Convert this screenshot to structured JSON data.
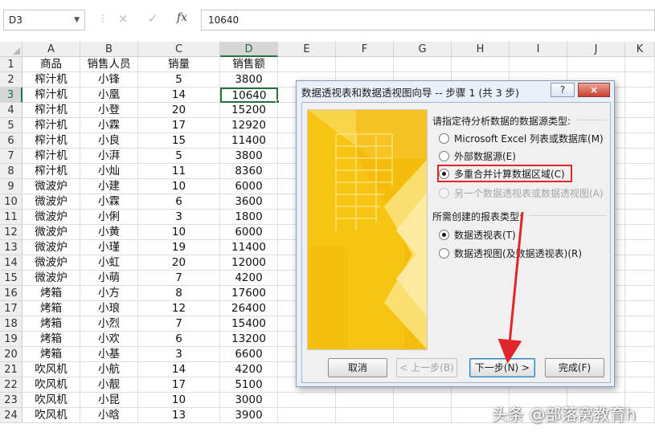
{
  "formula_bar": {
    "name_box": "D3",
    "cancel_icon": "×",
    "enter_icon": "✓",
    "fx_label": "fx",
    "value": "10640"
  },
  "columns": [
    "A",
    "B",
    "C",
    "D",
    "E",
    "F",
    "G",
    "H",
    "I",
    "J",
    "K"
  ],
  "rows": [
    [
      "1",
      "商品",
      "销售人员",
      "销量",
      "销售额"
    ],
    [
      "2",
      "榨汁机",
      "小锋",
      "5",
      "3800"
    ],
    [
      "3",
      "榨汁机",
      "小凰",
      "14",
      "10640"
    ],
    [
      "4",
      "榨汁机",
      "小登",
      "20",
      "15200"
    ],
    [
      "5",
      "榨汁机",
      "小霖",
      "17",
      "12920"
    ],
    [
      "6",
      "榨汁机",
      "小良",
      "15",
      "11400"
    ],
    [
      "7",
      "榨汁机",
      "小湃",
      "5",
      "3800"
    ],
    [
      "8",
      "榨汁机",
      "小灿",
      "11",
      "8360"
    ],
    [
      "9",
      "微波炉",
      "小建",
      "10",
      "6000"
    ],
    [
      "10",
      "微波炉",
      "小霖",
      "6",
      "3600"
    ],
    [
      "11",
      "微波炉",
      "小俐",
      "3",
      "1800"
    ],
    [
      "12",
      "微波炉",
      "小黄",
      "10",
      "6000"
    ],
    [
      "13",
      "微波炉",
      "小瑾",
      "19",
      "11400"
    ],
    [
      "14",
      "微波炉",
      "小虹",
      "20",
      "12000"
    ],
    [
      "15",
      "微波炉",
      "小萌",
      "7",
      "4200"
    ],
    [
      "16",
      "烤箱",
      "小方",
      "8",
      "17600"
    ],
    [
      "17",
      "烤箱",
      "小琅",
      "12",
      "26400"
    ],
    [
      "18",
      "烤箱",
      "小烈",
      "7",
      "15400"
    ],
    [
      "19",
      "烤箱",
      "小欢",
      "6",
      "13200"
    ],
    [
      "20",
      "烤箱",
      "小基",
      "3",
      "6600"
    ],
    [
      "21",
      "吹风机",
      "小航",
      "14",
      "4200"
    ],
    [
      "22",
      "吹风机",
      "小靓",
      "17",
      "5100"
    ],
    [
      "23",
      "吹风机",
      "小昆",
      "10",
      "3000"
    ],
    [
      "24",
      "吹风机",
      "小晗",
      "13",
      "3900"
    ]
  ],
  "dialog": {
    "title": "数据透视表和数据透视图向导 -- 步骤 1 (共 3 步)",
    "help_label": "?",
    "close_label": "×",
    "source_group_label": "请指定待分析数据的数据源类型:",
    "source_options": [
      "Microsoft Excel 列表或数据库(M)",
      "外部数据源(E)",
      "多重合并计算数据区域(C)",
      "另一个数据透视表或数据透视图(A)"
    ],
    "report_group_label": "所需创建的报表类型:",
    "report_options": [
      "数据透视表(T)",
      "数据透视图(及数据透视表)(R)"
    ],
    "buttons": {
      "cancel": "取消",
      "back": "< 上一步(B)",
      "next": "下一步(N) >",
      "finish": "完成(F)"
    }
  },
  "watermark": "头条 @部落窝教育h",
  "colors": {
    "excel_green": "#217346",
    "highlight_red": "#e0262b",
    "illustration_yellow": "#f6c514"
  }
}
